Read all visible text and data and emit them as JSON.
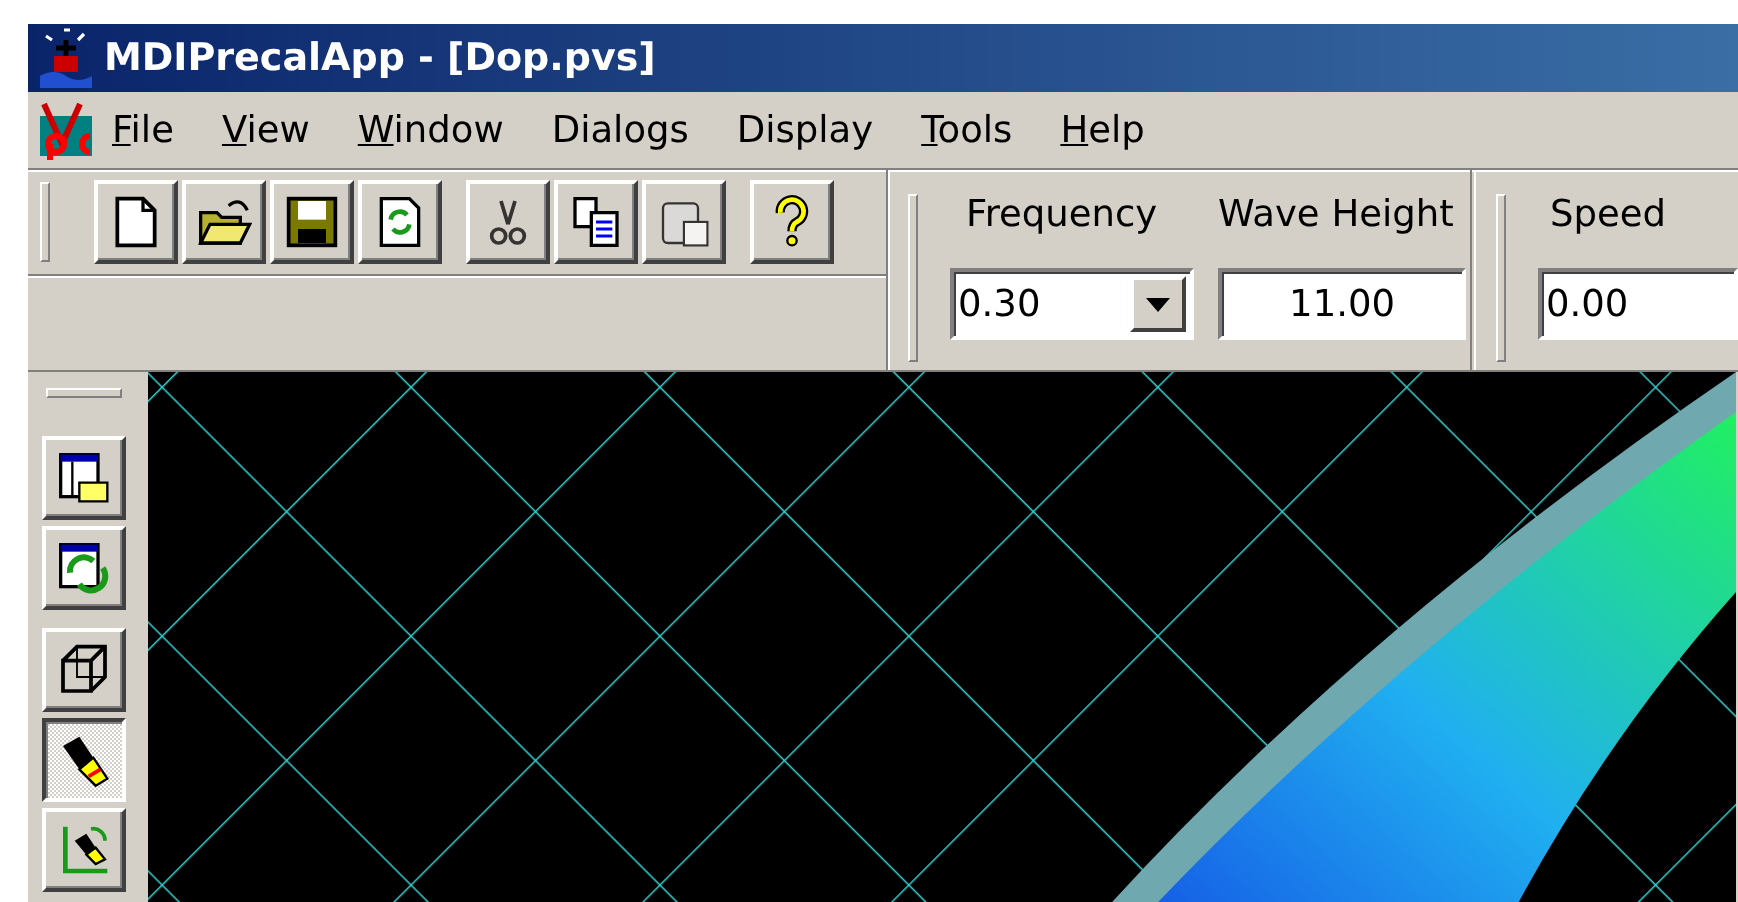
{
  "window": {
    "title": "MDIPrecalApp - [Dop.pvs]"
  },
  "menu": [
    {
      "accel": "F",
      "text": "ile"
    },
    {
      "accel": "V",
      "text": "iew"
    },
    {
      "accel": "W",
      "text": "indow"
    },
    {
      "text": "Dialogs"
    },
    {
      "text": "Display"
    },
    {
      "accel": "T",
      "text": "ools"
    },
    {
      "accel": "H",
      "text": "elp"
    }
  ],
  "toolbar": {
    "groups": [
      [
        {
          "kind": "new",
          "disabled": false
        },
        {
          "kind": "open",
          "disabled": false
        },
        {
          "kind": "save",
          "disabled": false
        },
        {
          "kind": "refresh",
          "disabled": false
        }
      ],
      [
        {
          "kind": "cut",
          "disabled": true
        },
        {
          "kind": "copy",
          "disabled": false
        },
        {
          "kind": "paste",
          "disabled": true
        }
      ],
      [
        {
          "kind": "help",
          "disabled": false
        }
      ]
    ]
  },
  "frequency": {
    "label": "Frequency",
    "value": "0.30"
  },
  "wave_height": {
    "label": "Wave Height",
    "value": "11.00"
  },
  "speed": {
    "label": "Speed",
    "value": "0.00"
  },
  "side_toolbar": [
    {
      "kind": "window-open",
      "checked": false
    },
    {
      "kind": "window-refresh",
      "checked": false
    },
    {
      "kind": "cube",
      "checked": false
    },
    {
      "kind": "light",
      "checked": true
    },
    {
      "kind": "axes-light",
      "checked": false
    }
  ]
}
